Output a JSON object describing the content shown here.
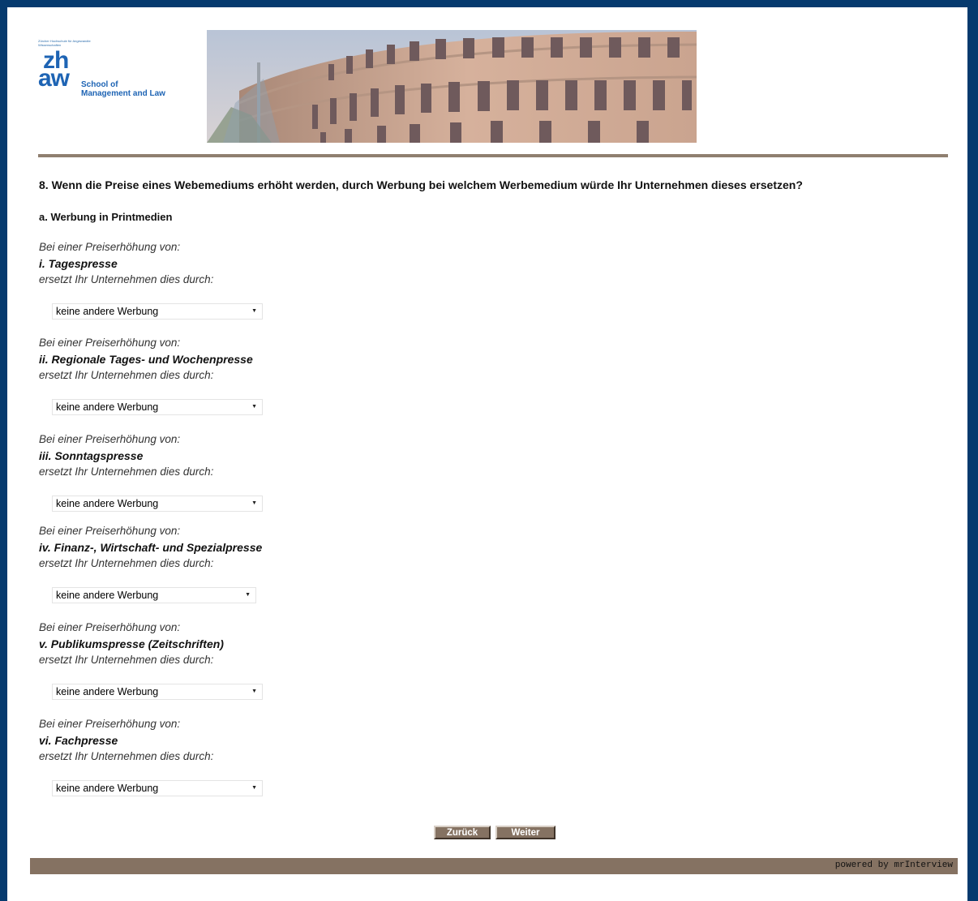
{
  "header": {
    "logo_small_text": "Zürcher Hochschule für Angewandte Wissenschaften",
    "logo_zh": "zh",
    "logo_aw": "aw",
    "logo_school_line1": "School of",
    "logo_school_line2": "Management and Law"
  },
  "question": {
    "title": "8. Wenn die Preise eines Webemediums erhöht werden, durch Werbung bei welchem Werbemedium würde Ihr Unternehmen dieses ersetzen?",
    "subtitle": "a. Werbung in Printmedien"
  },
  "items": [
    {
      "pre": "Bei einer Preiserhöhung von:",
      "label": "i. Tagespresse",
      "post": "ersetzt Ihr Unternehmen dies durch:",
      "selected": "keine andere Werbung"
    },
    {
      "pre": "Bei einer Preiserhöhung von:",
      "label": "ii. Regionale Tages- und Wochenpresse",
      "post": "ersetzt Ihr Unternehmen dies durch:",
      "selected": "keine andere Werbung"
    },
    {
      "pre": "Bei einer Preiserhöhung von:",
      "label": "iii. Sonntagspresse",
      "post": "ersetzt Ihr Unternehmen dies durch:",
      "selected": "keine andere Werbung"
    },
    {
      "pre": "Bei einer Preiserhöhung von:",
      "label": "iv. Finanz-, Wirtschaft- und Spezialpresse",
      "post": "ersetzt Ihr Unternehmen dies durch:",
      "selected": "keine andere Werbung"
    },
    {
      "pre": "Bei einer Preiserhöhung von:",
      "label": "v. Publikumspresse (Zeitschriften)",
      "post": "ersetzt Ihr Unternehmen dies durch:",
      "selected": "keine andere Werbung"
    },
    {
      "pre": "Bei einer Preiserhöhung von:",
      "label": "vi. Fachpresse",
      "post": "ersetzt Ihr Unternehmen dies durch:",
      "selected": "keine andere Werbung"
    }
  ],
  "buttons": {
    "back_label": "Zurück",
    "next_label": "Weiter"
  },
  "footer": {
    "powered_by": "powered by mrInterview"
  },
  "colors": {
    "frame": "#063a6e",
    "accent_brown": "#857262",
    "logo_blue": "#1e64b4"
  }
}
